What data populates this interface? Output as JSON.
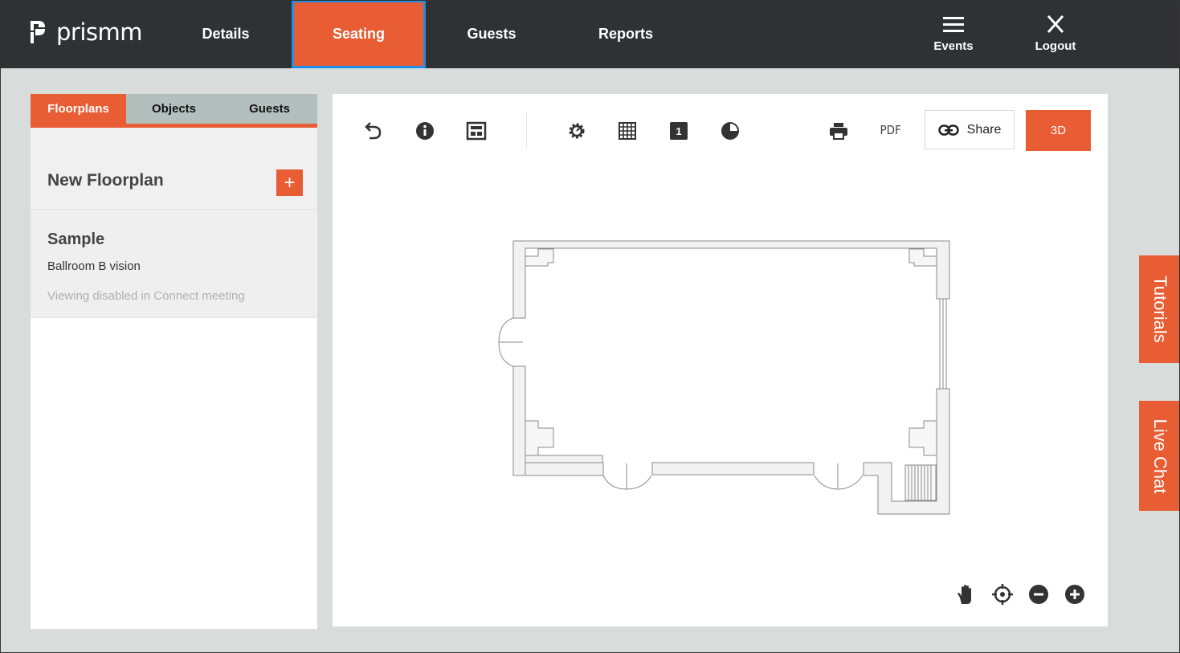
{
  "app": {
    "logo_text": "prismm"
  },
  "nav": {
    "items": [
      {
        "label": "Details"
      },
      {
        "label": "Seating"
      },
      {
        "label": "Guests"
      },
      {
        "label": "Reports"
      }
    ],
    "events_label": "Events",
    "logout_label": "Logout"
  },
  "left_panel": {
    "tabs": [
      {
        "label": "Floorplans"
      },
      {
        "label": "Objects"
      },
      {
        "label": "Guests"
      }
    ],
    "new_floorplan_label": "New Floorplan",
    "add_button": "+",
    "floorplans": [
      {
        "name": "Sample",
        "description": "Ballroom B vision",
        "note": "Viewing disabled in Connect meeting"
      }
    ]
  },
  "toolbar": {
    "icons": [
      "undo-icon",
      "info-icon",
      "layout-icon",
      "settings-icon",
      "grid-icon",
      "number-icon",
      "contrast-icon",
      "print-icon"
    ],
    "number_glyph": "1",
    "pdf_label": "PDF",
    "share_label": "Share",
    "threed_label": "3D"
  },
  "zoom_controls": [
    "pan-hand-icon",
    "recenter-icon",
    "zoom-out-icon",
    "zoom-in-icon"
  ],
  "side_tabs": {
    "tutorials": "Tutorials",
    "live_chat": "Live Chat"
  },
  "colors": {
    "accent": "#e85d33",
    "topbar": "#2f3135",
    "tabs_bg": "#b3bfbc",
    "page_bg": "#d8dcdb",
    "focus_ring": "#1e8fe6"
  }
}
